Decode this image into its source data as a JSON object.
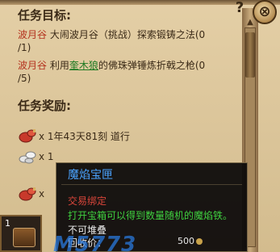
{
  "quest": {
    "goal_heading": "任务目标:",
    "tasks": [
      {
        "location": "波月谷",
        "text": "大闹波月谷（挑战）探索锻铸之法(0",
        "continuation": "/1)"
      },
      {
        "location": "波月谷",
        "prefix": "利用",
        "npc": "奎木狼",
        "suffix": "的佛珠弹锤炼折戟之枪(0",
        "continuation": "/5)"
      }
    ],
    "reward_heading": "任务奖励:",
    "rewards": [
      {
        "icon": "red-gourd-icon",
        "text": "x 1年43天81刻 道行"
      },
      {
        "icon": "silver-ingot-icon",
        "text": "x 1"
      },
      {
        "icon": "red-gourd-icon",
        "text": "x"
      }
    ]
  },
  "slot": {
    "count": "1",
    "icon": "chest-icon"
  },
  "tooltip": {
    "title": "魔焰宝匣",
    "binding": "交易绑定",
    "description": "打开宝箱可以得到数量随机的魔焰铁。",
    "stack": "不可堆叠",
    "price_label": "回收价：",
    "price_value": "500"
  },
  "controls": {
    "help": "?",
    "close": "⊗"
  },
  "watermark": "M5773",
  "colors": {
    "location": "#b4321f",
    "npc": "#1f7a23",
    "tooltip_title": "#4aa3ff",
    "binding": "#d9453a",
    "description": "#3fd03f"
  }
}
